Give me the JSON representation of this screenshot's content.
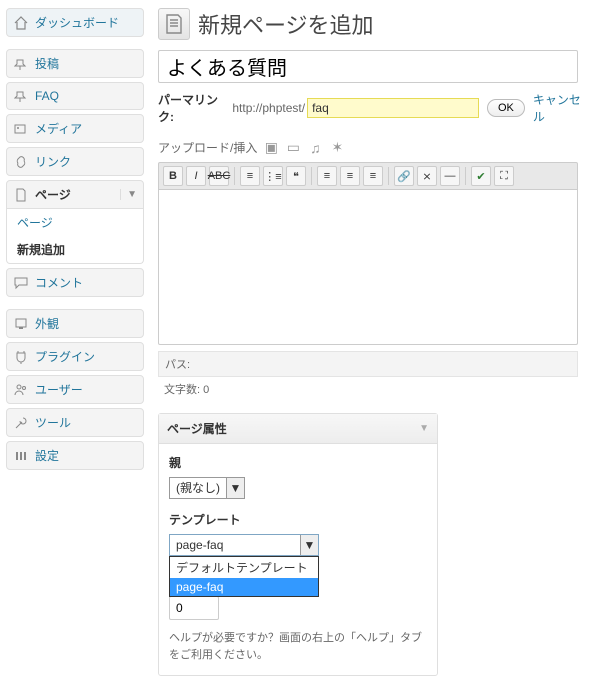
{
  "sidebar": {
    "dashboard": "ダッシュボード",
    "posts": "投稿",
    "faq": "FAQ",
    "media": "メディア",
    "links": "リンク",
    "pages": "ページ",
    "pages_sub_list": "ページ",
    "pages_sub_new": "新規追加",
    "comments": "コメント",
    "appearance": "外観",
    "plugins": "プラグイン",
    "users": "ユーザー",
    "tools": "ツール",
    "settings": "設定"
  },
  "page": {
    "heading": "新規ページを追加",
    "title_value": "よくある質問",
    "permalink_label": "パーマリンク:",
    "permalink_base": "http://phptest/",
    "slug_value": "faq",
    "ok": "OK",
    "cancel": "キャンセル",
    "upload_label": "アップロード/挿入"
  },
  "editor": {
    "path_label": "パス:",
    "count_label": "文字数:",
    "count_value": "0"
  },
  "attributes": {
    "box_title": "ページ属性",
    "parent_label": "親",
    "parent_value": "(親なし)",
    "template_label": "テンプレート",
    "template_value": "page-faq",
    "template_options": [
      "デフォルトテンプレート",
      "page-faq"
    ],
    "order_value": "0",
    "help_text": "ヘルプが必要ですか？画面の右上の「ヘルプ」タブをご利用ください。"
  }
}
